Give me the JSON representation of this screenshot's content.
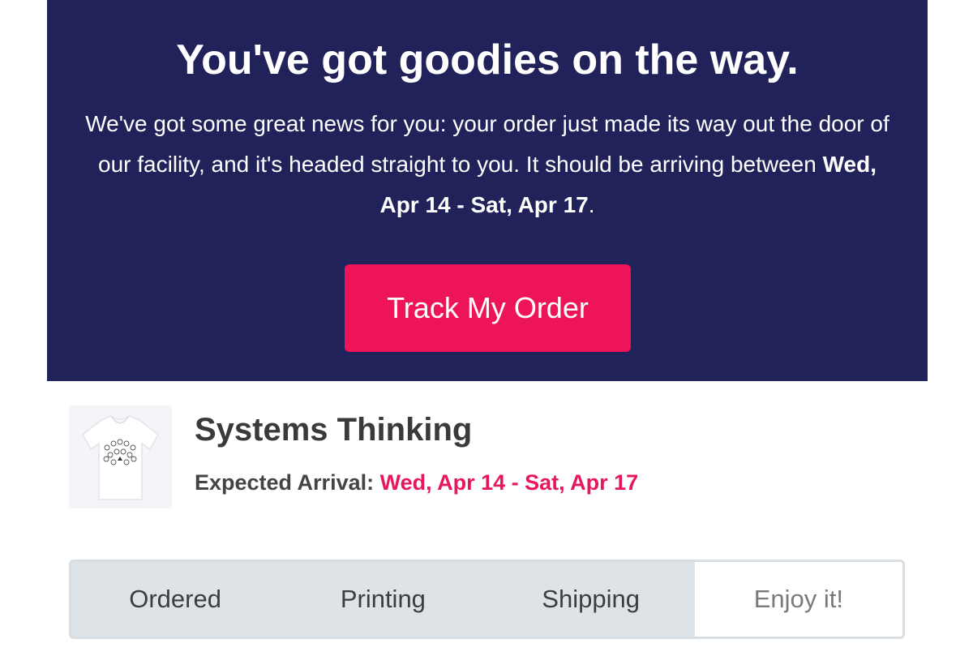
{
  "hero": {
    "title": "You've got goodies on the way.",
    "body_before": "We've got some great news for you: your order just made its way out the door of our facility, and it's headed straight to you. It should be arriving between ",
    "body_dates": "Wed, Apr 14 - Sat, Apr 17",
    "body_after": ".",
    "button_label": "Track My Order"
  },
  "product": {
    "name": "Systems Thinking",
    "arrival_label": "Expected Arrival: ",
    "arrival_dates": "Wed, Apr 14 - Sat, Apr 17",
    "thumbnail_icon": "tshirt-icon"
  },
  "progress": {
    "steps": [
      {
        "label": "Ordered"
      },
      {
        "label": "Printing"
      },
      {
        "label": "Shipping"
      },
      {
        "label": "Enjoy it!"
      }
    ],
    "current_step": "Enjoy it!"
  },
  "colors": {
    "hero_background": "#21225a",
    "accent": "#ed1557",
    "progress_background": "#dde3e7"
  }
}
